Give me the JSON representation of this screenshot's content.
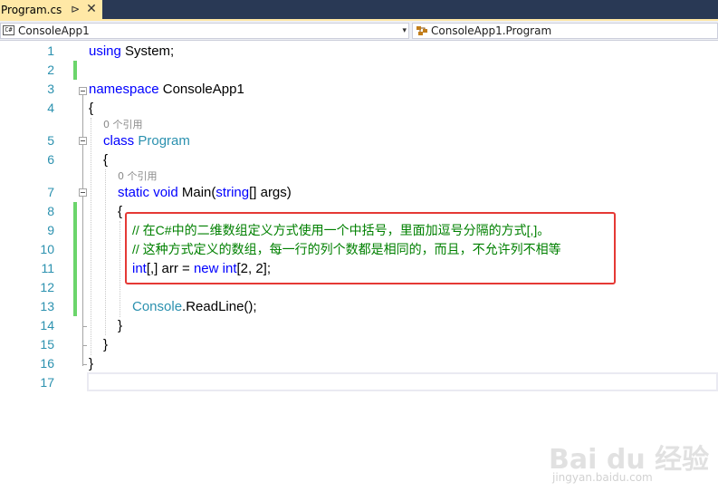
{
  "tab": {
    "title": "Program.cs",
    "pin_glyph": "⊳",
    "close_glyph": "✕"
  },
  "navbar": {
    "project_icon": "C#",
    "project": "ConsoleApp1",
    "scope_icon": "class-icon",
    "scope": "ConsoleApp1.Program",
    "dropdown_glyph": "▾"
  },
  "editor": {
    "line_numbers": [
      "1",
      "2",
      "3",
      "4",
      "5",
      "6",
      "7",
      "8",
      "9",
      "10",
      "11",
      "12",
      "13",
      "14",
      "15",
      "16",
      "17"
    ],
    "code_lens": {
      "class_refs": "0 个引用",
      "main_refs": "0 个引用"
    },
    "lines": {
      "l1": {
        "kw": "using",
        "rest": " System;"
      },
      "l3": {
        "kw": "namespace",
        "rest": " ConsoleApp1"
      },
      "l4": {
        "text": "{"
      },
      "l5": {
        "kw": "class",
        "type": "Program"
      },
      "l6": {
        "text": "{"
      },
      "l7": {
        "kw1": "static",
        "kw2": "void",
        "name": "Main(",
        "kw3": "string",
        "rest": "[] args)"
      },
      "l8": {
        "text": "{"
      },
      "l9": {
        "comment": "// 在C#中的二维数组定义方式使用一个中括号，里面加逗号分隔的方式[,]。"
      },
      "l10": {
        "comment": "// 这种方式定义的数组，每一行的列个数都是相同的，而且，不允许列不相等"
      },
      "l11": {
        "kw1": "int",
        "mid": "[,] arr = ",
        "kw2": "new",
        "kw3": "int",
        "rest": "[2, 2];"
      },
      "l13": {
        "type": "Console",
        "rest": ".ReadLine();"
      },
      "l14": {
        "text": "}"
      },
      "l15": {
        "text": "}"
      },
      "l16": {
        "text": "}"
      }
    }
  },
  "watermark": {
    "logo": "Bai du 经验",
    "url": "jingyan.baidu.com"
  },
  "colors": {
    "keyword": "#0000ff",
    "type": "#2b91af",
    "comment": "#008000",
    "line_number": "#2b91af",
    "change_bar": "#6bd56b",
    "highlight_box": "#e53935",
    "tab_active": "#ffe8a6",
    "tabstrip_bg": "#293955"
  }
}
